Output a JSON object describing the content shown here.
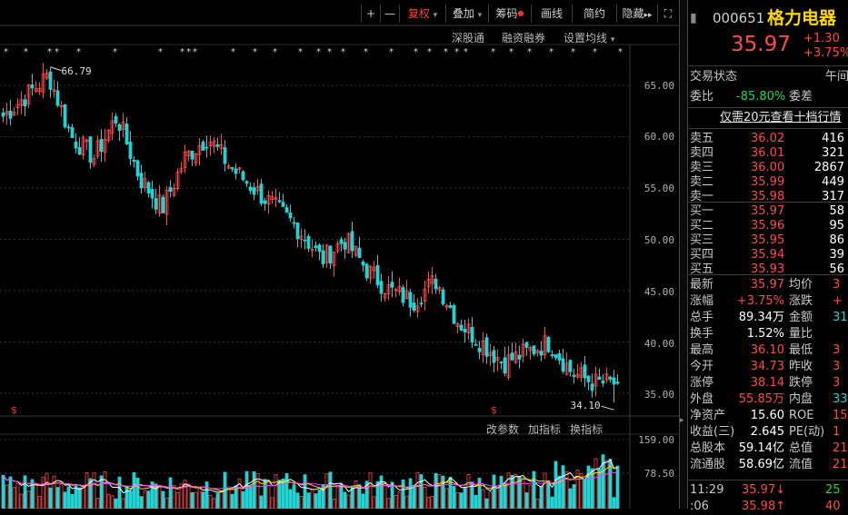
{
  "toolbar": {
    "zoom_in": "+",
    "zoom_out": "—",
    "fuquan": "复权",
    "overlay": "叠加",
    "chip": "筹码",
    "draw": "画线",
    "simple": "简约",
    "hide": "隐藏"
  },
  "subbar": {
    "shengutong": "深股通",
    "margin": "融资融券",
    "ma_setting": "设置均线"
  },
  "price_axis": [
    "65.00",
    "60.00",
    "55.00",
    "50.00",
    "45.00",
    "40.00",
    "35.00"
  ],
  "max_label": "66.79",
  "min_label": "34.10",
  "lower_toolbar": {
    "change_param": "改参数",
    "add_indicator": "加指标",
    "switch_indicator": "换指标"
  },
  "volume_axis": [
    "159.00",
    "78.50"
  ],
  "stock": {
    "code": "000651",
    "name": "格力电器",
    "price": "35.97",
    "change": "+1.30",
    "change_pct": "+3.75%"
  },
  "trade_state": {
    "label": "交易状态",
    "value": "午间"
  },
  "weibi": {
    "label": "委比",
    "value": "-85.80%",
    "label2": "委差"
  },
  "promo": "仅需20元查看十档行情",
  "asks": [
    {
      "label": "卖五",
      "price": "36.02",
      "vol": "416"
    },
    {
      "label": "卖四",
      "price": "36.01",
      "vol": "321"
    },
    {
      "label": "卖三",
      "price": "36.00",
      "vol": "2867"
    },
    {
      "label": "卖二",
      "price": "35.99",
      "vol": "449"
    },
    {
      "label": "卖一",
      "price": "35.98",
      "vol": "317"
    }
  ],
  "bids": [
    {
      "label": "买一",
      "price": "35.97",
      "vol": "58"
    },
    {
      "label": "买二",
      "price": "35.96",
      "vol": "95"
    },
    {
      "label": "买三",
      "price": "35.95",
      "vol": "86"
    },
    {
      "label": "买四",
      "price": "35.94",
      "vol": "39"
    },
    {
      "label": "买五",
      "price": "35.93",
      "vol": "56"
    }
  ],
  "stats": [
    {
      "l1": "最新",
      "v1": "35.97",
      "c1": "red",
      "l2": "均价",
      "v2": "3"
    },
    {
      "l1": "涨幅",
      "v1": "+3.75%",
      "c1": "red",
      "l2": "涨跌",
      "v2": "+"
    },
    {
      "l1": "总手",
      "v1": "89.34万",
      "c1": "white",
      "l2": "金额",
      "v2": "31."
    },
    {
      "l1": "换手",
      "v1": "1.52%",
      "c1": "white",
      "l2": "量比",
      "v2": ""
    },
    {
      "l1": "最高",
      "v1": "36.10",
      "c1": "red",
      "l2": "最低",
      "v2": "3"
    },
    {
      "l1": "今开",
      "v1": "34.73",
      "c1": "red",
      "l2": "昨收",
      "v2": "3"
    },
    {
      "l1": "涨停",
      "v1": "38.14",
      "c1": "red",
      "l2": "跌停",
      "v2": "3"
    },
    {
      "l1": "外盘",
      "v1": "55.85万",
      "c1": "red",
      "l2": "内盘",
      "v2": "33."
    },
    {
      "l1": "净资产",
      "v1": "15.60",
      "c1": "white",
      "l2": "ROE",
      "v2": "15"
    },
    {
      "l1": "收益(三)",
      "v1": "2.645",
      "c1": "white",
      "l2": "PE(动)",
      "v2": "1"
    },
    {
      "l1": "总股本",
      "v1": "59.14亿",
      "c1": "white",
      "l2": "总值",
      "v2": "21"
    },
    {
      "l1": "流通股",
      "v1": "58.69亿",
      "c1": "white",
      "l2": "流值",
      "v2": "21"
    }
  ],
  "ticks": [
    {
      "time": "11:29",
      "price": "35.97",
      "arrow": "↓",
      "vol": "25"
    },
    {
      "time": ":06",
      "price": "35.98",
      "arrow": "↑",
      "vol": "40"
    }
  ],
  "colors": {
    "up": "#ff4a4a",
    "down": "#23d2d2",
    "ma_white": "#ffffff",
    "ma_yellow": "#ffd700",
    "ma_magenta": "#ff40ff"
  },
  "chart_data": {
    "type": "candlestick",
    "price_range": [
      34.1,
      66.79
    ],
    "visible_high": 66.79,
    "visible_low": 34.1,
    "key_closes_approx": [
      62,
      64,
      66,
      60,
      58,
      62,
      56,
      53,
      58,
      60,
      57,
      55,
      53,
      51,
      48,
      50,
      47,
      45,
      44,
      46,
      42,
      40,
      38,
      39,
      40,
      37,
      36,
      35.97
    ],
    "volume_axis_max": 159.0
  }
}
